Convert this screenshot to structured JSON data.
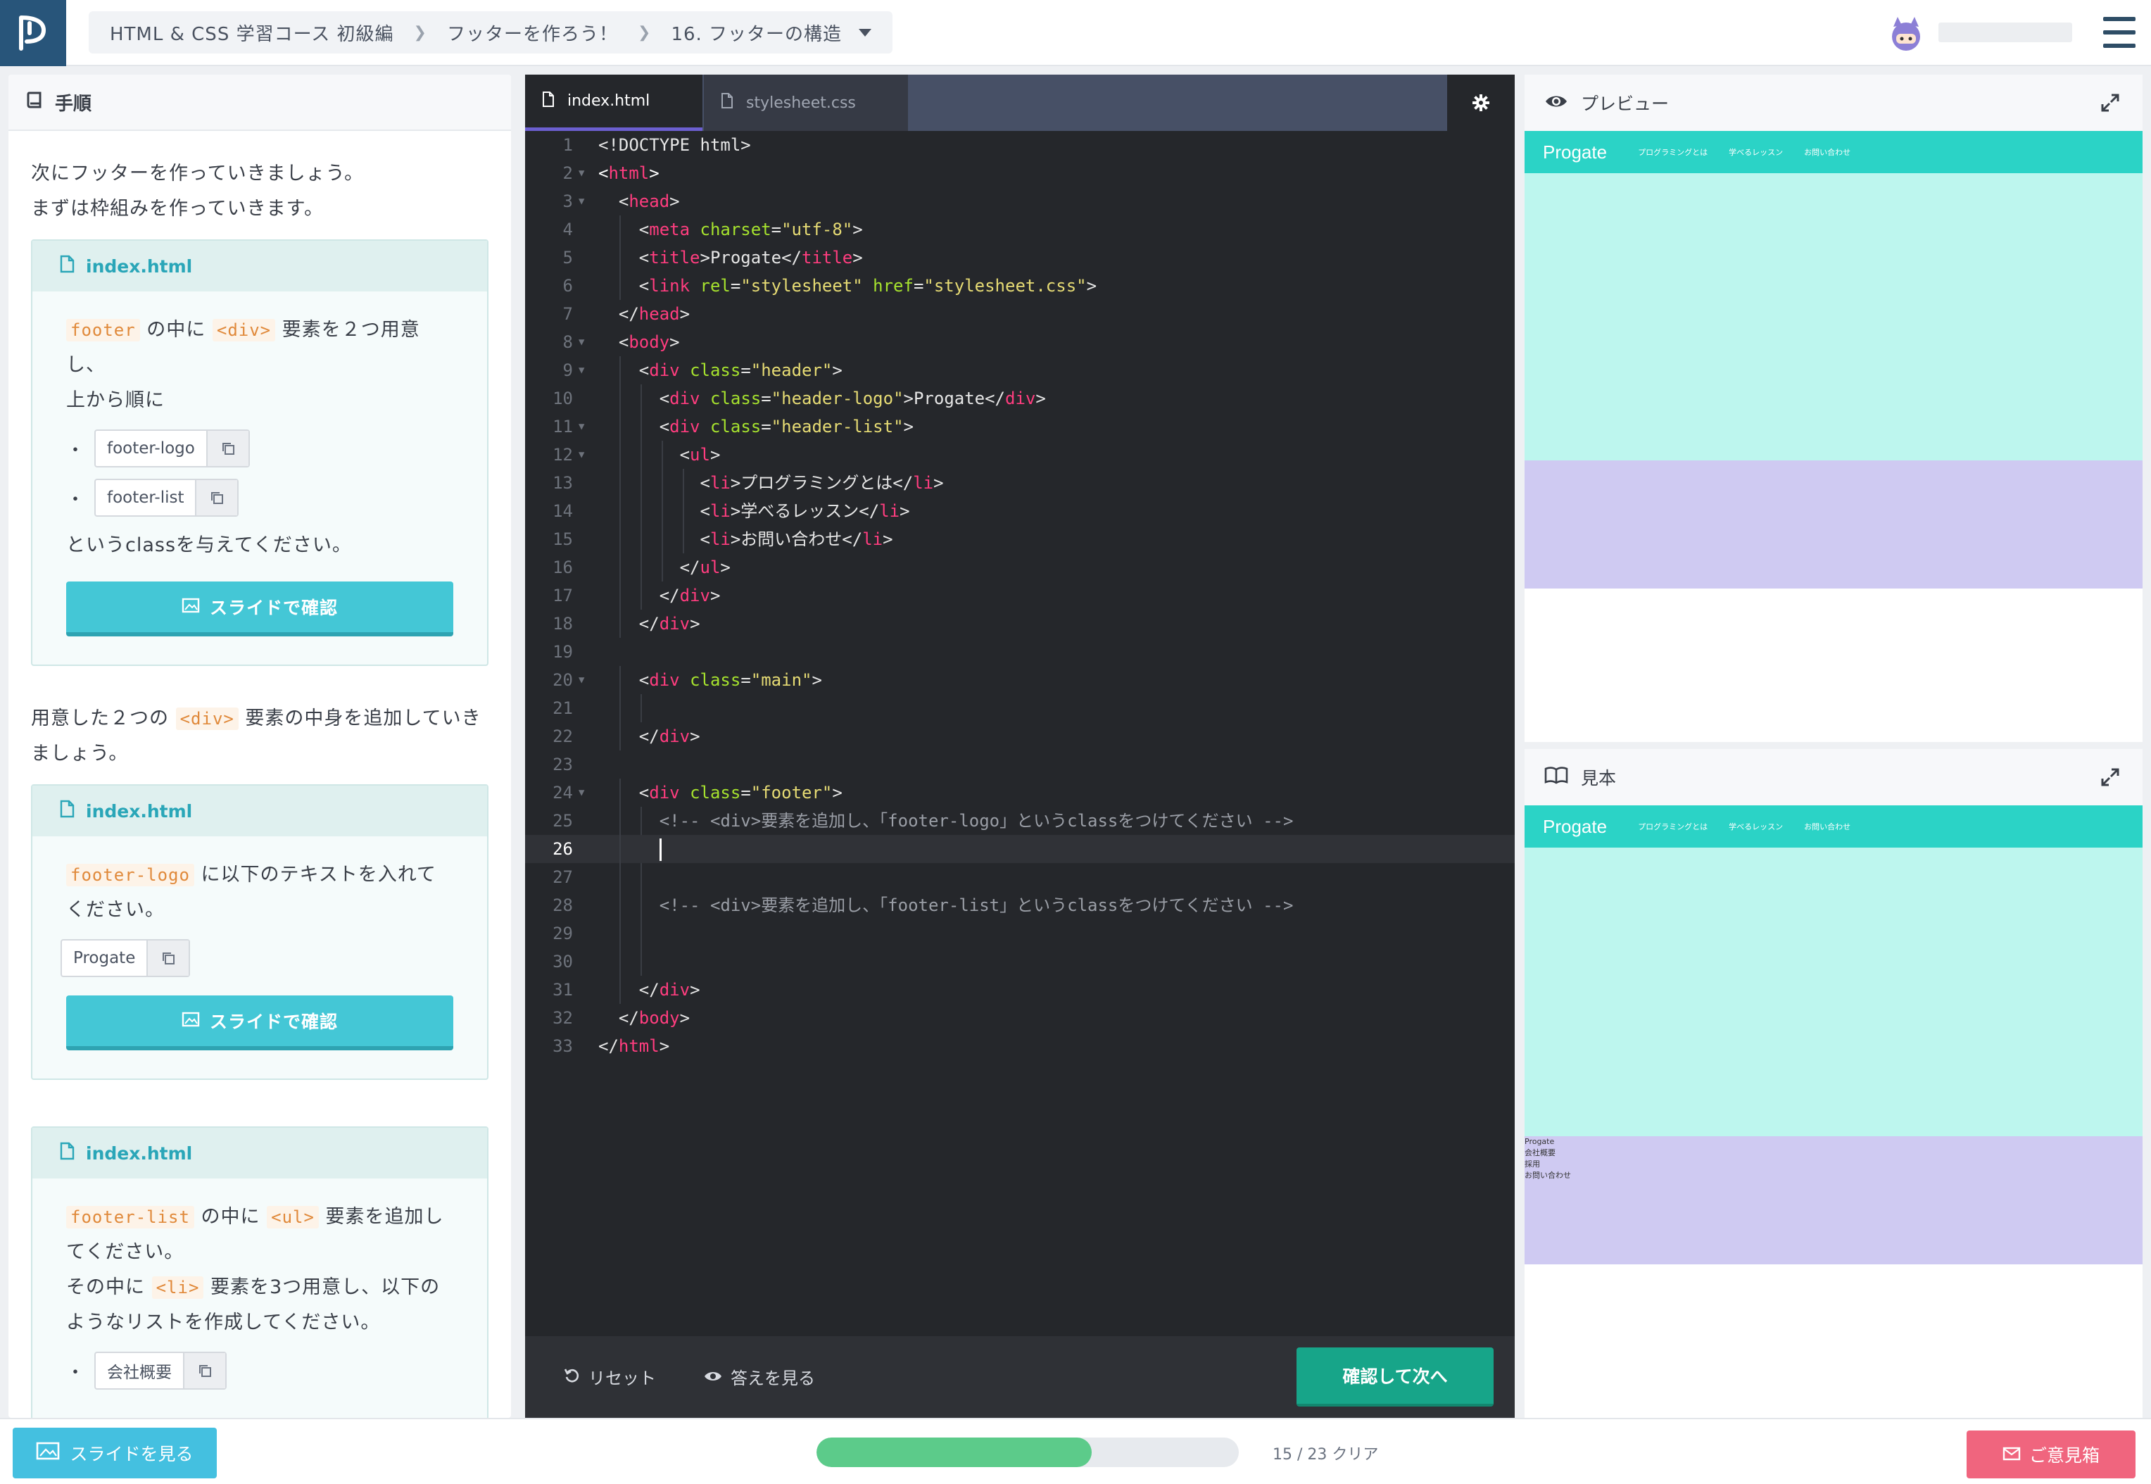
{
  "breadcrumb": {
    "course": "HTML & CSS 学習コース 初級編",
    "chapter": "フッターを作ろう！",
    "lesson": "16. フッターの構造"
  },
  "left_panel": {
    "title": "手順",
    "intro_line1": "次にフッターを作っていきましょう。",
    "intro_line2": "まずは枠組みを作っていきます。",
    "card1": {
      "file": "index.html",
      "code1": "footer",
      "text1": " の中に ",
      "code2": "<div>",
      "text2": " 要素を２つ用意し、",
      "text3": "上から順に",
      "chips": [
        "footer-logo",
        "footer-list"
      ],
      "text4": "というclassを与えてください。",
      "slide_label": "スライドで確認"
    },
    "para2": {
      "pre": "用意した２つの ",
      "code": "<div>",
      "post": " 要素の中身を追加していきましょう。"
    },
    "card2": {
      "file": "index.html",
      "code1": "footer-logo",
      "text1": " に以下のテキストを入れてください。",
      "chip": "Progate",
      "slide_label": "スライドで確認"
    },
    "card3": {
      "file": "index.html",
      "code1": "footer-list",
      "text1": " の中に ",
      "code2": "<ul>",
      "text2": " 要素を追加してください。",
      "text3": "その中に ",
      "code3": "<li>",
      "text4": " 要素を3つ用意し、以下のようなリストを作成してください。",
      "chip": "会社概要"
    }
  },
  "editor": {
    "tab_active": "index.html",
    "tab_inactive": "stylesheet.css",
    "reset_label": "リセット",
    "answer_label": "答えを見る",
    "next_label": "確認して次へ",
    "lines": [
      "1",
      "2",
      "3",
      "4",
      "5",
      "6",
      "7",
      "8",
      "9",
      "10",
      "11",
      "12",
      "13",
      "14",
      "15",
      "16",
      "17",
      "18",
      "19",
      "20",
      "21",
      "22",
      "23",
      "24",
      "25",
      "26",
      "27",
      "28",
      "29",
      "30",
      "31",
      "32",
      "33"
    ]
  },
  "preview": {
    "title": "プレビュー",
    "site_logo": "Progate",
    "nav": [
      "プログラミングとは",
      "学べるレッスン",
      "お問い合わせ"
    ]
  },
  "sample": {
    "title": "見本",
    "site_logo": "Progate",
    "nav": [
      "プログラミングとは",
      "学べるレッスン",
      "お問い合わせ"
    ],
    "footer_lines": [
      "Progate",
      "会社概要",
      "採用",
      "お問い合わせ"
    ]
  },
  "bottom": {
    "slides_label": "スライドを見る",
    "progress_current": 15,
    "progress_total": 23,
    "progress_text": "15 / 23 クリア",
    "feedback_label": "ご意見箱"
  },
  "colors": {
    "accent_teal": "#44c7d6",
    "next_green": "#17a589",
    "progress_green": "#5ccb8a",
    "feedback_pink": "#f0657e",
    "preview_header": "#2bd3c6",
    "preview_main": "#bdf6ee",
    "preview_footer": "#cfcaf2"
  }
}
